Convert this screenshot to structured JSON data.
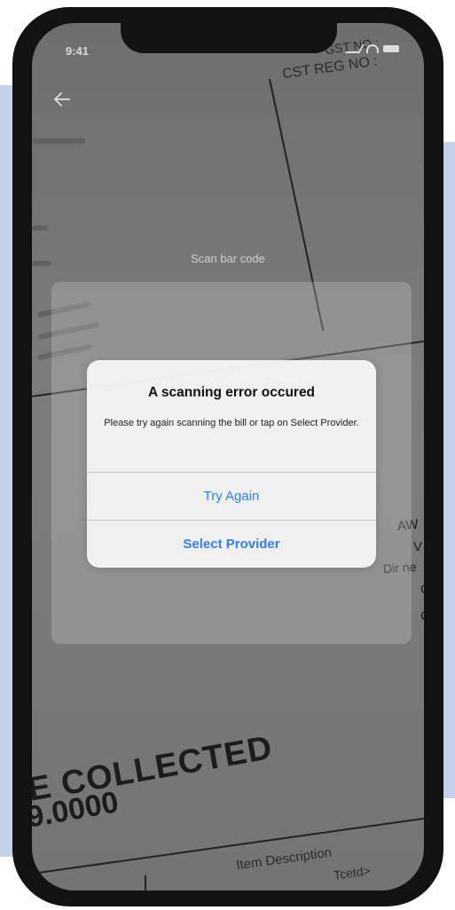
{
  "status_bar": {
    "time": "9:41"
  },
  "receipt": {
    "gst_label": "GST NO :",
    "cst_label": "CST REG NO :",
    "collected_label": "E COLLECTED",
    "amount": "9.0000",
    "item_description_header": "Item Description",
    "tcetd_label": "Tcetd>",
    "side_aw": "AW",
    "side_v": "V",
    "side_dine": "Dir ne",
    "side_c1": "C",
    "side_c2": "C"
  },
  "scanner": {
    "label": "Scan bar code"
  },
  "dialog": {
    "title": "A scanning error occured",
    "message": "Please try again scanning the bill or tap on Select Provider.",
    "try_again_label": "Try Again",
    "select_provider_label": "Select Provider"
  },
  "colors": {
    "accent": "#2f7ef5",
    "background_panel": "#c4d1ea",
    "phone_frame": "#121212"
  }
}
